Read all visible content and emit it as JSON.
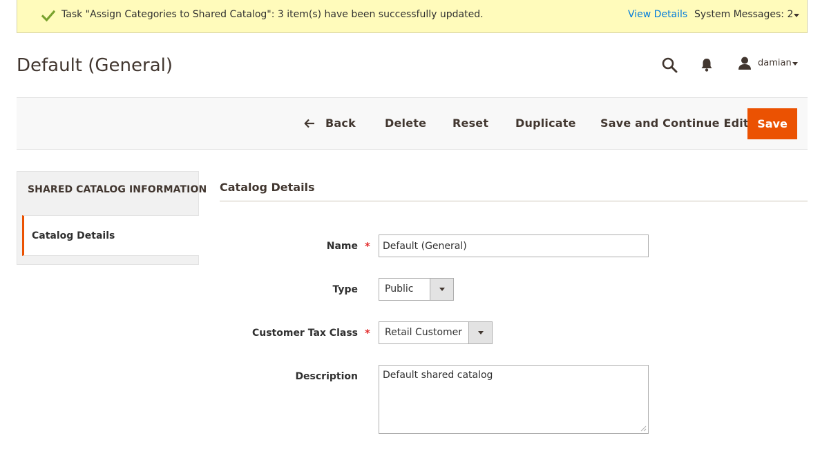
{
  "system_message": {
    "text": "Task \"Assign Categories to Shared Catalog\": 3 item(s) have been successfully updated.",
    "view_details": "View Details",
    "system_messages": "System Messages: 2",
    "icon": "checkmark-icon"
  },
  "header": {
    "title": "Default (General)",
    "user_name": "damian",
    "icons": [
      "search-icon",
      "bell-icon",
      "user-icon"
    ]
  },
  "actions": {
    "back": "Back",
    "delete": "Delete",
    "reset": "Reset",
    "duplicate": "Duplicate",
    "save_continue": "Save and Continue Edit",
    "save": "Save"
  },
  "sidebar": {
    "heading": "SHARED CATALOG INFORMATION",
    "items": [
      {
        "label": "Catalog Details",
        "active": true
      }
    ]
  },
  "form": {
    "section_title": "Catalog Details",
    "name": {
      "label": "Name",
      "value": "Default (General)",
      "required": true
    },
    "type": {
      "label": "Type",
      "value": "Public"
    },
    "tax_class": {
      "label": "Customer Tax Class",
      "value": "Retail Customer",
      "required": true
    },
    "description": {
      "label": "Description",
      "value": "Default shared catalog"
    }
  },
  "colors": {
    "accent": "#eb5202",
    "message_bg": "#fffbbb",
    "link": "#007bdb",
    "success": "#79a22e",
    "required": "#e22626"
  }
}
